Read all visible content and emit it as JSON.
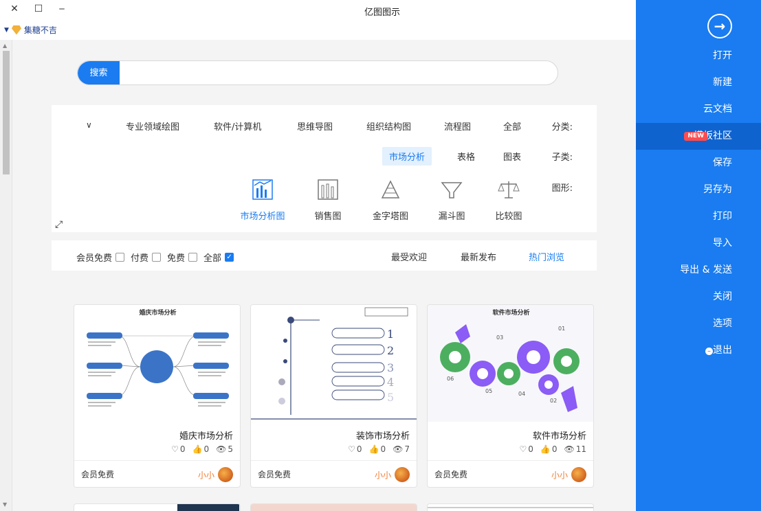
{
  "window": {
    "title": "亿图图示",
    "close_glyph": "✕",
    "maximize_glyph": "☐",
    "minimize_glyph": "‒"
  },
  "user": {
    "name": "集糖不吉"
  },
  "sidebar": {
    "items": [
      {
        "label": "打开"
      },
      {
        "label": "新建"
      },
      {
        "label": "云文档"
      },
      {
        "label": "模板社区",
        "badge": "NEW",
        "active": true
      },
      {
        "label": "保存"
      },
      {
        "label": "另存为"
      },
      {
        "label": "打印"
      },
      {
        "label": "导入"
      },
      {
        "label": "导出 & 发送"
      },
      {
        "label": "关闭"
      },
      {
        "label": "选项"
      },
      {
        "label": "退出"
      }
    ]
  },
  "search": {
    "button_label": "搜索",
    "placeholder": ""
  },
  "filters": {
    "category_label": "分类:",
    "categories": [
      "全部",
      "流程图",
      "组织结构图",
      "思维导图",
      "软件/计算机",
      "专业领域绘图"
    ],
    "subcategory_label": "子类:",
    "subcategories": [
      "图表",
      "表格",
      "市场分析"
    ],
    "selected_subcategory": "市场分析",
    "shape_label": "图形:",
    "shapes": [
      "比较图",
      "漏斗图",
      "金字塔图",
      "销售图",
      "市场分析图"
    ],
    "selected_shape": "市场分析图"
  },
  "sort": {
    "tabs": [
      "热门浏览",
      "最新发布",
      "最受欢迎"
    ],
    "active_tab": "热门浏览",
    "price_filters": [
      "全部",
      "免费",
      "付费",
      "会员免费"
    ],
    "checked_filter": "全部"
  },
  "cards": [
    {
      "title": "软件市场分析",
      "views": "11",
      "likes": "0",
      "favorites": "0",
      "author": "小小",
      "price": "会员免费",
      "thumb_title": "软件市场分析"
    },
    {
      "title": "装饰市场分析",
      "views": "7",
      "likes": "0",
      "favorites": "0",
      "author": "小小",
      "price": "会员免费",
      "thumb_title": "装饰市场分析"
    },
    {
      "title": "婚庆市场分析",
      "views": "5",
      "likes": "0",
      "favorites": "0",
      "author": "小小",
      "price": "会员免费",
      "thumb_title": "婚庆市场分析"
    }
  ],
  "colors": {
    "accent": "#1a7cf0",
    "new_badge": "#ff4d4f",
    "author": "#f07c34"
  }
}
